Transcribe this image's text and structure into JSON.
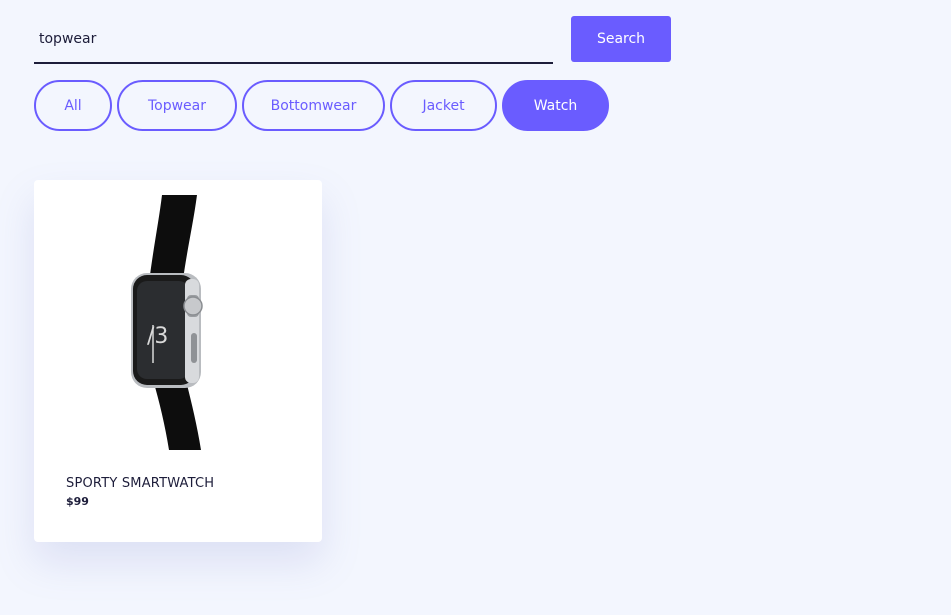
{
  "search": {
    "value": "topwear",
    "button_label": "Search"
  },
  "filters": [
    {
      "label": "All",
      "active": false
    },
    {
      "label": "Topwear",
      "active": false
    },
    {
      "label": "Bottomwear",
      "active": false
    },
    {
      "label": "Jacket",
      "active": false
    },
    {
      "label": "Watch",
      "active": true
    }
  ],
  "products": [
    {
      "name": "SPORTY SMARTWATCH",
      "price": "$99",
      "image_icon": "smartwatch-image"
    }
  ],
  "colors": {
    "accent": "#6a5cff",
    "background": "#f3f6fe",
    "text": "#1d1d3a"
  }
}
